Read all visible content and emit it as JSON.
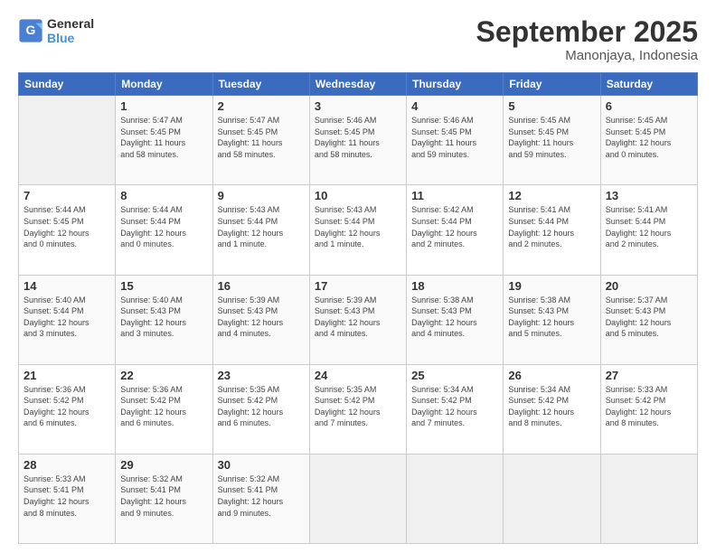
{
  "logo": {
    "line1": "General",
    "line2": "Blue"
  },
  "title": "September 2025",
  "location": "Manonjaya, Indonesia",
  "days_of_week": [
    "Sunday",
    "Monday",
    "Tuesday",
    "Wednesday",
    "Thursday",
    "Friday",
    "Saturday"
  ],
  "weeks": [
    [
      {
        "day": "",
        "info": ""
      },
      {
        "day": "1",
        "info": "Sunrise: 5:47 AM\nSunset: 5:45 PM\nDaylight: 11 hours\nand 58 minutes."
      },
      {
        "day": "2",
        "info": "Sunrise: 5:47 AM\nSunset: 5:45 PM\nDaylight: 11 hours\nand 58 minutes."
      },
      {
        "day": "3",
        "info": "Sunrise: 5:46 AM\nSunset: 5:45 PM\nDaylight: 11 hours\nand 58 minutes."
      },
      {
        "day": "4",
        "info": "Sunrise: 5:46 AM\nSunset: 5:45 PM\nDaylight: 11 hours\nand 59 minutes."
      },
      {
        "day": "5",
        "info": "Sunrise: 5:45 AM\nSunset: 5:45 PM\nDaylight: 11 hours\nand 59 minutes."
      },
      {
        "day": "6",
        "info": "Sunrise: 5:45 AM\nSunset: 5:45 PM\nDaylight: 12 hours\nand 0 minutes."
      }
    ],
    [
      {
        "day": "7",
        "info": "Sunrise: 5:44 AM\nSunset: 5:45 PM\nDaylight: 12 hours\nand 0 minutes."
      },
      {
        "day": "8",
        "info": "Sunrise: 5:44 AM\nSunset: 5:44 PM\nDaylight: 12 hours\nand 0 minutes."
      },
      {
        "day": "9",
        "info": "Sunrise: 5:43 AM\nSunset: 5:44 PM\nDaylight: 12 hours\nand 1 minute."
      },
      {
        "day": "10",
        "info": "Sunrise: 5:43 AM\nSunset: 5:44 PM\nDaylight: 12 hours\nand 1 minute."
      },
      {
        "day": "11",
        "info": "Sunrise: 5:42 AM\nSunset: 5:44 PM\nDaylight: 12 hours\nand 2 minutes."
      },
      {
        "day": "12",
        "info": "Sunrise: 5:41 AM\nSunset: 5:44 PM\nDaylight: 12 hours\nand 2 minutes."
      },
      {
        "day": "13",
        "info": "Sunrise: 5:41 AM\nSunset: 5:44 PM\nDaylight: 12 hours\nand 2 minutes."
      }
    ],
    [
      {
        "day": "14",
        "info": "Sunrise: 5:40 AM\nSunset: 5:44 PM\nDaylight: 12 hours\nand 3 minutes."
      },
      {
        "day": "15",
        "info": "Sunrise: 5:40 AM\nSunset: 5:43 PM\nDaylight: 12 hours\nand 3 minutes."
      },
      {
        "day": "16",
        "info": "Sunrise: 5:39 AM\nSunset: 5:43 PM\nDaylight: 12 hours\nand 4 minutes."
      },
      {
        "day": "17",
        "info": "Sunrise: 5:39 AM\nSunset: 5:43 PM\nDaylight: 12 hours\nand 4 minutes."
      },
      {
        "day": "18",
        "info": "Sunrise: 5:38 AM\nSunset: 5:43 PM\nDaylight: 12 hours\nand 4 minutes."
      },
      {
        "day": "19",
        "info": "Sunrise: 5:38 AM\nSunset: 5:43 PM\nDaylight: 12 hours\nand 5 minutes."
      },
      {
        "day": "20",
        "info": "Sunrise: 5:37 AM\nSunset: 5:43 PM\nDaylight: 12 hours\nand 5 minutes."
      }
    ],
    [
      {
        "day": "21",
        "info": "Sunrise: 5:36 AM\nSunset: 5:42 PM\nDaylight: 12 hours\nand 6 minutes."
      },
      {
        "day": "22",
        "info": "Sunrise: 5:36 AM\nSunset: 5:42 PM\nDaylight: 12 hours\nand 6 minutes."
      },
      {
        "day": "23",
        "info": "Sunrise: 5:35 AM\nSunset: 5:42 PM\nDaylight: 12 hours\nand 6 minutes."
      },
      {
        "day": "24",
        "info": "Sunrise: 5:35 AM\nSunset: 5:42 PM\nDaylight: 12 hours\nand 7 minutes."
      },
      {
        "day": "25",
        "info": "Sunrise: 5:34 AM\nSunset: 5:42 PM\nDaylight: 12 hours\nand 7 minutes."
      },
      {
        "day": "26",
        "info": "Sunrise: 5:34 AM\nSunset: 5:42 PM\nDaylight: 12 hours\nand 8 minutes."
      },
      {
        "day": "27",
        "info": "Sunrise: 5:33 AM\nSunset: 5:42 PM\nDaylight: 12 hours\nand 8 minutes."
      }
    ],
    [
      {
        "day": "28",
        "info": "Sunrise: 5:33 AM\nSunset: 5:41 PM\nDaylight: 12 hours\nand 8 minutes."
      },
      {
        "day": "29",
        "info": "Sunrise: 5:32 AM\nSunset: 5:41 PM\nDaylight: 12 hours\nand 9 minutes."
      },
      {
        "day": "30",
        "info": "Sunrise: 5:32 AM\nSunset: 5:41 PM\nDaylight: 12 hours\nand 9 minutes."
      },
      {
        "day": "",
        "info": ""
      },
      {
        "day": "",
        "info": ""
      },
      {
        "day": "",
        "info": ""
      },
      {
        "day": "",
        "info": ""
      }
    ]
  ]
}
